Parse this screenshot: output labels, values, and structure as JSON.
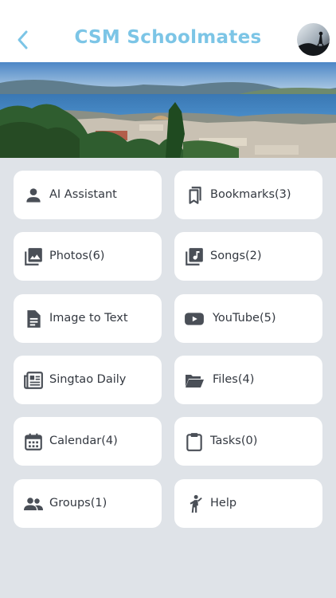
{
  "header": {
    "title": "CSM Schoolmates",
    "back_icon": "chevron-left-icon",
    "accent": "#7cc5e6"
  },
  "menu": [
    {
      "label": "AI Assistant",
      "icon": "person-icon"
    },
    {
      "label": "Bookmarks(3)",
      "icon": "bookmarks-icon"
    },
    {
      "label": "Photos(6)",
      "icon": "photo-library-icon"
    },
    {
      "label": "Songs(2)",
      "icon": "music-library-icon"
    },
    {
      "label": "Image to Text",
      "icon": "document-icon"
    },
    {
      "label": "YouTube(5)",
      "icon": "youtube-icon"
    },
    {
      "label": "Singtao Daily",
      "icon": "newspaper-icon"
    },
    {
      "label": "Files(4)",
      "icon": "folder-open-icon"
    },
    {
      "label": "Calendar(4)",
      "icon": "calendar-icon"
    },
    {
      "label": "Tasks(0)",
      "icon": "clipboard-icon"
    },
    {
      "label": "Groups(1)",
      "icon": "groups-icon"
    },
    {
      "label": "Help",
      "icon": "help-person-icon"
    }
  ]
}
